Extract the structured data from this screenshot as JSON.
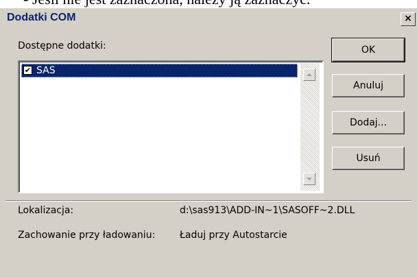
{
  "background_text": "- Jeśli nie jest zaznaczona, należy ją zaznaczyć.",
  "dialog": {
    "title": "Dodatki COM",
    "close_label": "×"
  },
  "addins": {
    "label": "Dostępne dodatki:",
    "items": [
      {
        "label": "SAS",
        "checked": true,
        "check_glyph": "✔"
      }
    ]
  },
  "buttons": {
    "ok": "OK",
    "cancel": "Anuluj",
    "add": "Dodaj...",
    "remove": "Usuń"
  },
  "details": {
    "location_label": "Lokalizacja:",
    "location_value": "d:\\sas913\\ADD-IN~1\\SASOFF~2.DLL",
    "load_behavior_label": "Zachowanie przy ładowaniu:",
    "load_behavior_value": "Ładuj przy Autostarcie"
  },
  "colors": {
    "dialog_bg": "#d4d0c8",
    "selection": "#0a246a",
    "title_text": "#0a246a"
  }
}
